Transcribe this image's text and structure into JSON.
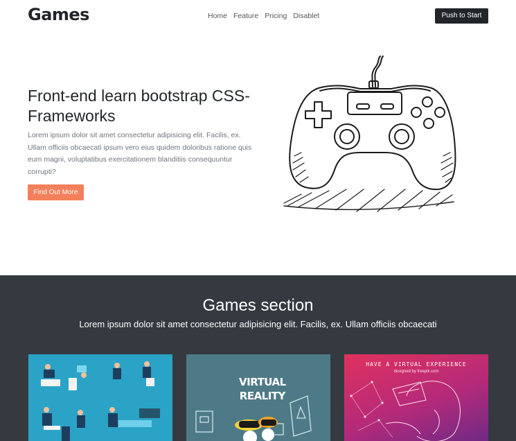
{
  "navbar": {
    "brand": "Games",
    "links": [
      "Home",
      "Feature",
      "Pricing",
      "Disablet"
    ],
    "cta": "Push to Start"
  },
  "hero": {
    "title": "Front-end learn bootstrap CSS-Frameworks",
    "text": "Lorem ipsum dolor sit amet consectetur adipisicing elit. Facilis, ex. Ullam officiis obcaecati ipsum vero eius quidem doloribus ratione quis eum magni, voluptatibus exercitationem blanditiis consequuntur corrupti?",
    "button": "Find Out More",
    "image_icon": "gamepad-illustration"
  },
  "games": {
    "title": "Games section",
    "subtitle": "Lorem ipsum dolor sit amet consectetur adipisicing elit. Facilis, ex. Ullam officiis obcaecati",
    "cards": [
      {
        "image": "isometric-gamers-illustration",
        "caption": ""
      },
      {
        "image": "virtual-reality-illustration",
        "caption_line1": "VIRTUAL",
        "caption_line2": "REALITY"
      },
      {
        "image": "vr-headset-woman-illustration",
        "caption": "HAVE A VIRTUAL EXPERIENCE",
        "credit": "designed by freepik.com"
      }
    ]
  },
  "colors": {
    "dark": "#343a40",
    "accent": "#f47f5b",
    "card1": "#2ba3c6",
    "card2": "#4e7a87",
    "card3": "#e0315d"
  }
}
